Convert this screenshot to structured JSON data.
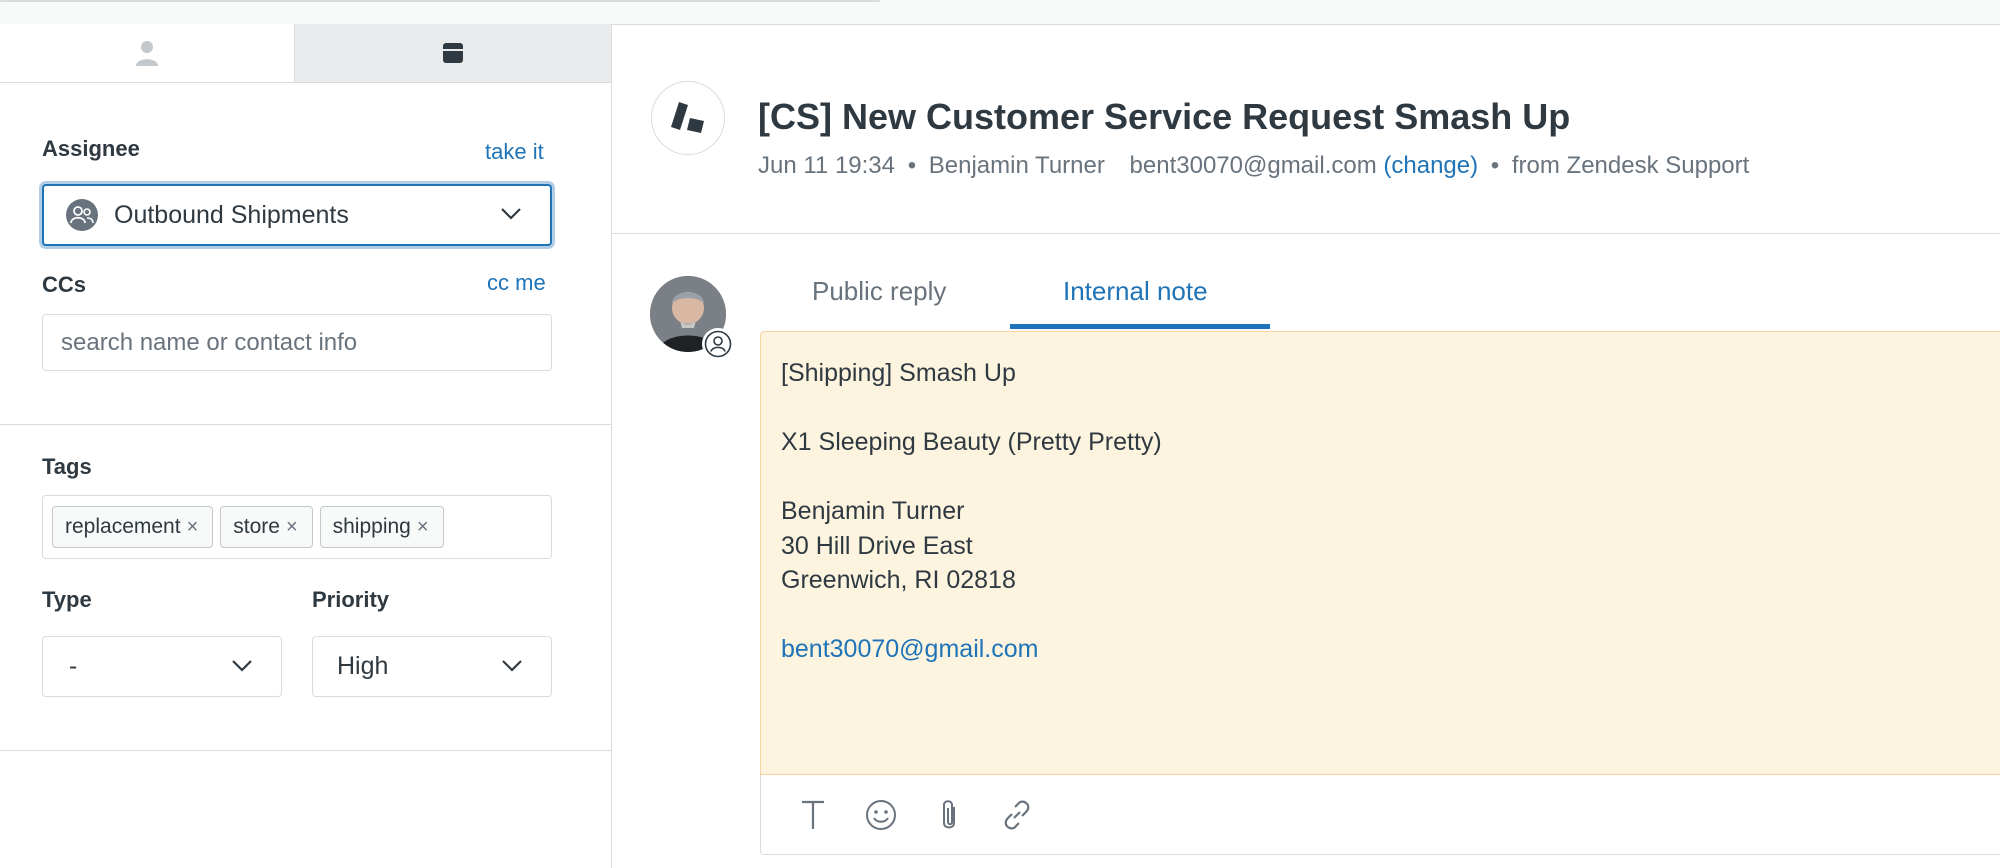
{
  "sidebar": {
    "tabs": [
      {
        "icon": "user-icon"
      },
      {
        "icon": "card-icon"
      }
    ],
    "assignee": {
      "label": "Assignee",
      "action": "take it",
      "value": "Outbound Shipments",
      "icon": "group-icon"
    },
    "ccs": {
      "label": "CCs",
      "action": "cc me",
      "placeholder": "search name or contact info"
    },
    "tags": {
      "label": "Tags",
      "items": [
        "replacement",
        "store",
        "shipping"
      ],
      "remove_glyph": "×"
    },
    "type": {
      "label": "Type",
      "value": "-"
    },
    "priority": {
      "label": "Priority",
      "value": "High"
    }
  },
  "ticket": {
    "title": "[CS] New Customer Service Request Smash Up",
    "date": "Jun 11 19:34",
    "bullet": "•",
    "requester": "Benjamin Turner",
    "email": "bent30070@gmail.com",
    "change": "(change)",
    "source": "from Zendesk Support"
  },
  "reply": {
    "tabs": [
      "Public reply",
      "Internal note"
    ],
    "active_tab": "Internal note",
    "lines": [
      "[Shipping] Smash Up",
      "",
      "X1 Sleeping Beauty (Pretty Pretty)",
      "",
      "Benjamin Turner",
      "30 Hill Drive East",
      "Greenwich, RI 02818",
      "",
      "bent30070@gmail.com"
    ],
    "toolbar": [
      "text-format-icon",
      "emoji-icon",
      "attachment-icon",
      "link-icon"
    ]
  },
  "colors": {
    "accent": "#1f73b7",
    "note_background": "#fdf4df",
    "note_border": "#f5d4a1",
    "text": "#2f3941",
    "muted": "#68737d",
    "border": "#d8dcde"
  }
}
